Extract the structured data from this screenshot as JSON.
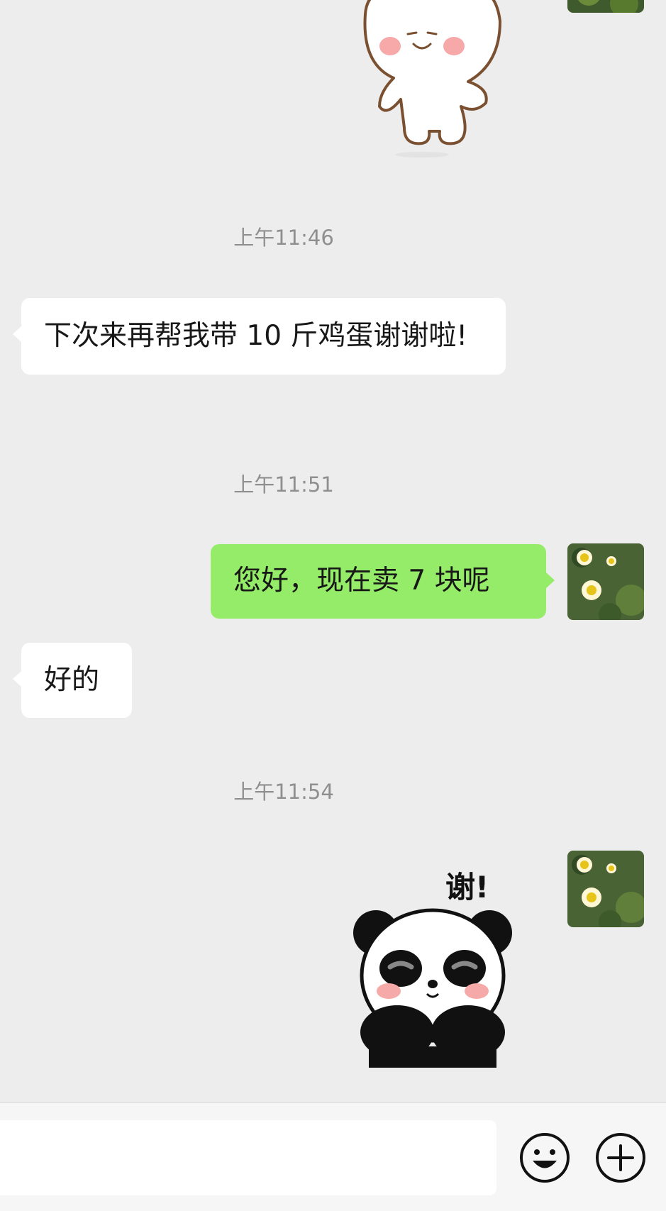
{
  "messages": {
    "ts1": "上午11:46",
    "msg1": "下次来再帮我带 10 斤鸡蛋谢谢啦!",
    "ts2": "上午11:51",
    "msg2": "您好，现在卖 7 块呢",
    "msg3": "好的",
    "ts3": "上午11:54"
  },
  "stickers": {
    "bear": "bear-smiling-sticker",
    "panda": "panda-thanks-sticker",
    "panda_text": "谢!"
  },
  "input_bar": {
    "placeholder": "",
    "emoji_icon": "emoji-icon",
    "plus_icon": "plus-icon"
  },
  "colors": {
    "background": "#ededed",
    "incoming_bubble": "#ffffff",
    "outgoing_bubble": "#95ec69",
    "timestamp": "#8f8f8f"
  }
}
